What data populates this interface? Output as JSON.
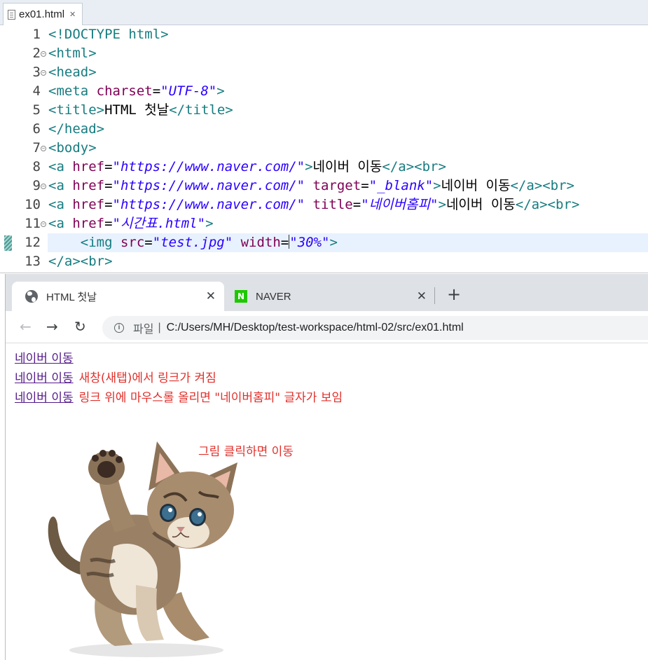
{
  "editor": {
    "tab_label": "ex01.html",
    "tab_close": "✕",
    "lines": [
      {
        "num": "1",
        "parts": [
          [
            "t",
            "<!DOCTYPE html>"
          ]
        ]
      },
      {
        "num": "2",
        "fold": true,
        "parts": [
          [
            "t",
            "<html>"
          ]
        ]
      },
      {
        "num": "3",
        "fold": true,
        "parts": [
          [
            "t",
            "<head>"
          ]
        ]
      },
      {
        "num": "4",
        "parts": [
          [
            "t",
            "<meta "
          ],
          [
            "a",
            "charset"
          ],
          [
            "x",
            "="
          ],
          [
            "v",
            "\"UTF-8\""
          ],
          [
            "t",
            ">"
          ]
        ]
      },
      {
        "num": "5",
        "parts": [
          [
            "t",
            "<title>"
          ],
          [
            "x",
            "HTML 첫날"
          ],
          [
            "t",
            "</title>"
          ]
        ]
      },
      {
        "num": "6",
        "parts": [
          [
            "t",
            "</head>"
          ]
        ]
      },
      {
        "num": "7",
        "fold": true,
        "parts": [
          [
            "t",
            "<body>"
          ]
        ]
      },
      {
        "num": "8",
        "parts": [
          [
            "t",
            "<a "
          ],
          [
            "a",
            "href"
          ],
          [
            "x",
            "="
          ],
          [
            "v",
            "\"https://www.naver.com/\""
          ],
          [
            "t",
            ">"
          ],
          [
            "x",
            "네이버 이동"
          ],
          [
            "t",
            "</a><br>"
          ]
        ]
      },
      {
        "num": "9",
        "fold": true,
        "parts": [
          [
            "t",
            "<a "
          ],
          [
            "a",
            "href"
          ],
          [
            "x",
            "="
          ],
          [
            "v",
            "\"https://www.naver.com/\""
          ],
          [
            "x",
            " "
          ],
          [
            "a",
            "target"
          ],
          [
            "x",
            "="
          ],
          [
            "v",
            "\"_blank\""
          ],
          [
            "t",
            ">"
          ],
          [
            "x",
            "네이버 이동"
          ],
          [
            "t",
            "</a><br>"
          ]
        ]
      },
      {
        "num": "10",
        "parts": [
          [
            "t",
            "<a "
          ],
          [
            "a",
            "href"
          ],
          [
            "x",
            "="
          ],
          [
            "v",
            "\"https://www.naver.com/\""
          ],
          [
            "x",
            " "
          ],
          [
            "a",
            "title"
          ],
          [
            "x",
            "="
          ],
          [
            "v",
            "\"네이버홈피\""
          ],
          [
            "t",
            ">"
          ],
          [
            "x",
            "네이버 이동"
          ],
          [
            "t",
            "</a><br>"
          ]
        ]
      },
      {
        "num": "11",
        "fold": true,
        "parts": [
          [
            "t",
            "<a "
          ],
          [
            "a",
            "href"
          ],
          [
            "x",
            "="
          ],
          [
            "v",
            "\"시간표.html\""
          ],
          [
            "t",
            ">"
          ]
        ]
      },
      {
        "num": "12",
        "active": true,
        "marker": true,
        "parts": [
          [
            "x",
            "    "
          ],
          [
            "t",
            "<img "
          ],
          [
            "a",
            "src"
          ],
          [
            "x",
            "="
          ],
          [
            "v",
            "\"test.jpg\""
          ],
          [
            "x",
            " "
          ],
          [
            "a",
            "width"
          ],
          [
            "x",
            "="
          ],
          [
            "c",
            ""
          ],
          [
            "v",
            "\"30%\""
          ],
          [
            "t",
            ">"
          ]
        ]
      },
      {
        "num": "13",
        "parts": [
          [
            "t",
            "</a><br>"
          ]
        ]
      }
    ]
  },
  "browser": {
    "tabs": [
      {
        "title": "HTML 첫날",
        "icon": "globe-icon",
        "close": "✕"
      },
      {
        "title": "NAVER",
        "icon": "naver-icon",
        "icon_text": "N",
        "close": "✕"
      }
    ],
    "new_tab": "+",
    "nav": {
      "back": "←",
      "forward": "→",
      "reload": "↻"
    },
    "address": {
      "info": "i",
      "scheme": "파일",
      "pipe": "|",
      "url": "C:/Users/MH/Desktop/test-workspace/html-02/src/ex01.html"
    },
    "page": {
      "links": [
        {
          "text": "네이버 이동",
          "note": ""
        },
        {
          "text": "네이버 이동",
          "note": "새창(새탭)에서 링크가 켜짐"
        },
        {
          "text": "네이버 이동",
          "note": "링크 위에 마우스롤 올리면 \"네이버홈피\"  글자가 보임"
        }
      ],
      "image_note": "그림 클릭하면 이동",
      "image_alt": "kitten"
    }
  },
  "colors": {
    "tag": "#167c80",
    "attr": "#7f0055",
    "value": "#2a00ff",
    "visited_link": "#551a8b",
    "note": "#e0312c"
  }
}
